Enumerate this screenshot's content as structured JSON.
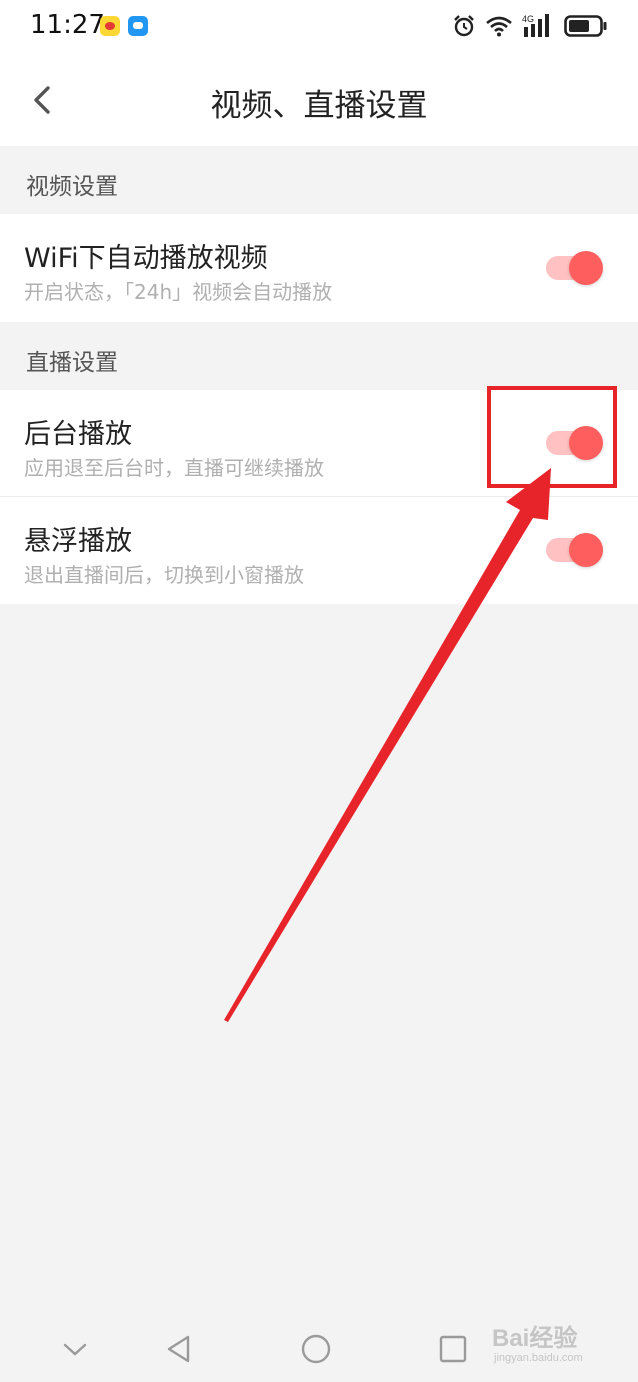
{
  "status_bar": {
    "time": "11:27",
    "network": "4G",
    "icons": [
      "weibo-icon",
      "message-icon",
      "alarm-icon",
      "wifi-icon",
      "signal-icon",
      "battery-icon"
    ]
  },
  "nav": {
    "title": "视频、直播设置",
    "back_icon": "chevron-left-icon"
  },
  "sections": [
    {
      "header": "视频设置",
      "items": [
        {
          "title": "WiFi下自动播放视频",
          "subtitle": "开启状态，「24h」视频会自动播放",
          "enabled": true
        }
      ]
    },
    {
      "header": "直播设置",
      "items": [
        {
          "title": "后台播放",
          "subtitle": "应用退至后台时，直播可继续播放",
          "enabled": true
        },
        {
          "title": "悬浮播放",
          "subtitle": "退出直播间后，切换到小窗播放",
          "enabled": true
        }
      ]
    }
  ],
  "system_nav": [
    "chevron-down-icon",
    "back-triangle-icon",
    "home-circle-icon",
    "recents-square-icon"
  ],
  "watermark": {
    "brand": "Bai经验",
    "url": "jingyan.baidu.com"
  },
  "colors": {
    "accent": "#fe5e5e",
    "track": "#ffc1c1",
    "annotation": "#e8242b",
    "background": "#f3f3f3"
  }
}
